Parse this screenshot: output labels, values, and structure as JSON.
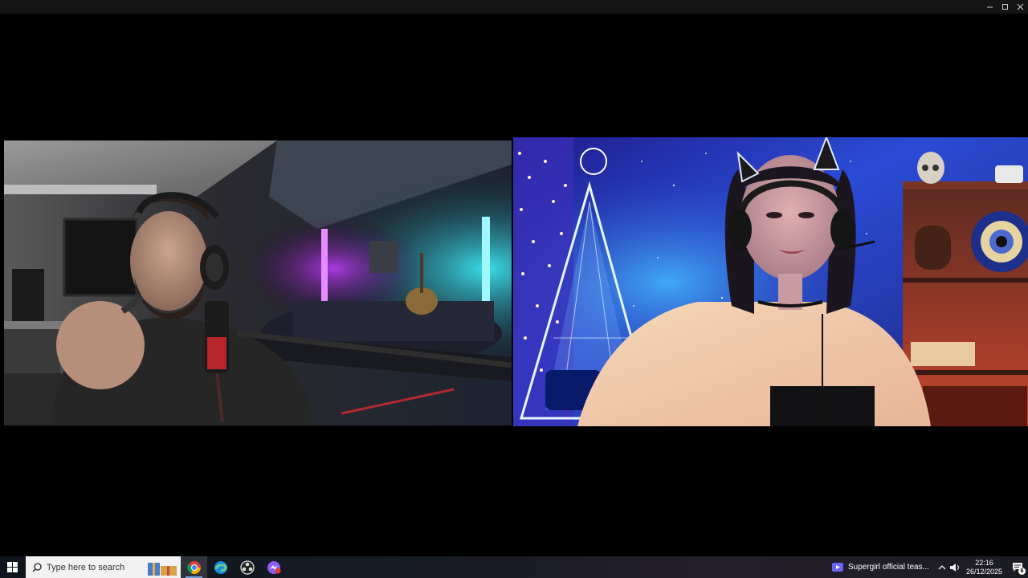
{
  "window": {
    "controls": {
      "minimize": "minimize",
      "maximize": "maximize",
      "close": "close"
    }
  },
  "videos": [
    {
      "participant": "left-participant",
      "description": "man with headphones and microphone in neon-lit room"
    },
    {
      "participant": "right-participant",
      "description": "woman with cat-ear headphones in front of galaxy backdrop"
    }
  ],
  "taskbar": {
    "search_placeholder": "Type here to search",
    "apps": [
      {
        "name": "chrome-icon",
        "active": true
      },
      {
        "name": "edge-icon",
        "active": false
      },
      {
        "name": "obs-icon",
        "active": false
      },
      {
        "name": "messenger-icon",
        "active": false
      }
    ],
    "media_title": "Supergirl official teas...",
    "clock": {
      "time": "22:16",
      "date": "26/12/2025"
    },
    "notification_count": "6"
  }
}
